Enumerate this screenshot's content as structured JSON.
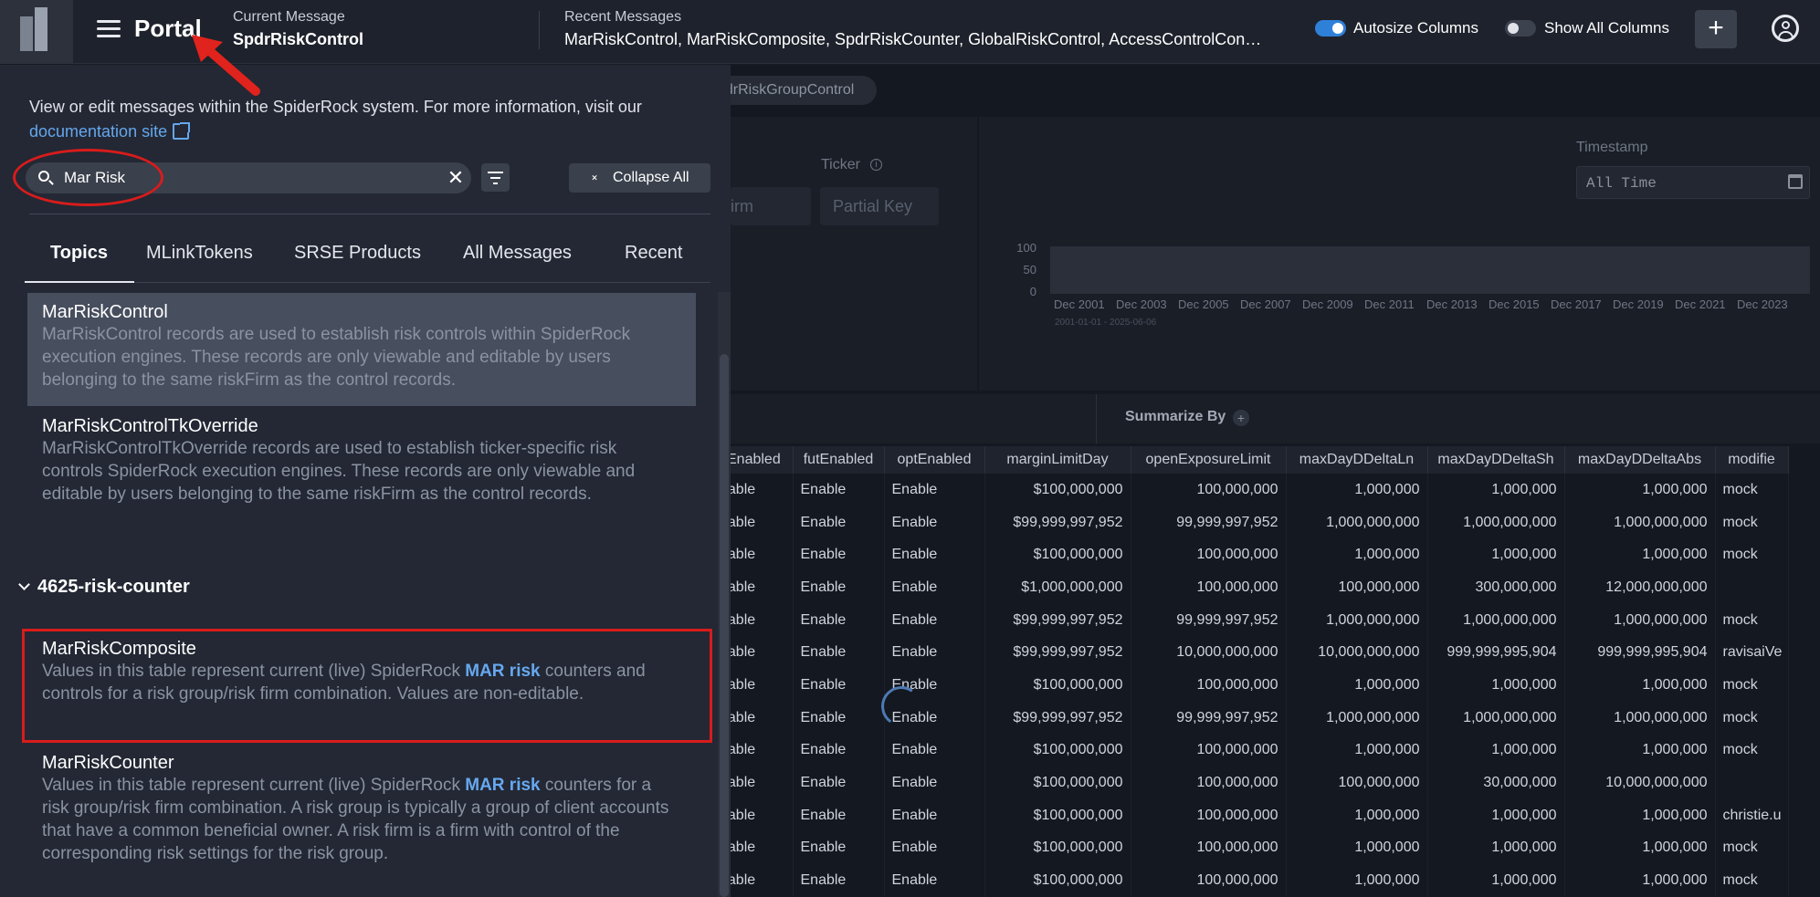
{
  "topbar": {
    "app_title": "Portal",
    "current_message_label": "Current Message",
    "current_message_value": "SpdrRiskControl",
    "recent_messages_label": "Recent Messages",
    "recent_messages_value": "MarRiskControl, MarRiskComposite, SpdrRiskCounter, GlobalRiskControl, AccessControlCon…",
    "autosize_label": "Autosize Columns",
    "autosize_on": true,
    "show_all_label": "Show All Columns",
    "show_all_on": false,
    "add_label": "+"
  },
  "drawer": {
    "intro_text": "View or edit messages within the SpiderRock system. For more information, visit our ",
    "doc_link": "documentation site",
    "search_value": "Mar Risk",
    "clear_label": "✕",
    "collapse_label": "Collapse All",
    "tabs": [
      "Topics",
      "MLinkTokens",
      "SRSE Products",
      "All Messages",
      "Recent"
    ],
    "active_tab": "Topics",
    "items_top": [
      {
        "title": "MarRiskControl",
        "desc": "MarRiskControl records are used to establish risk controls within SpiderRock execution engines. These records are only viewable and editable by users belonging to the same riskFirm as the control records."
      },
      {
        "title": "MarRiskControlTkOverride",
        "desc": "MarRiskControlTkOverride records are used to establish ticker-specific risk controls SpiderRock execution engines. These records are only viewable and editable by users belonging to the same riskFirm as the control records."
      }
    ],
    "group_label": "4625-risk-counter",
    "items_group": [
      {
        "title": "MarRiskComposite",
        "desc_pre": "Values in this table represent current (live) SpiderRock ",
        "desc_hl": "MAR risk",
        "desc_post": " counters and controls for a risk group/risk firm combination. Values are non-editable."
      },
      {
        "title": "MarRiskCounter",
        "desc_pre": "Values in this table represent current (live) SpiderRock ",
        "desc_hl": "MAR risk",
        "desc_post": " counters for a risk group/risk firm combination. A risk group is typically a group of client accounts that have a common beneficial owner. A risk firm is a firm with control of the corresponding risk settings for the risk group."
      }
    ]
  },
  "background": {
    "chip_label": "pdrRiskGroupControl",
    "ticker_label": "Ticker",
    "firm_placeholder": "irm",
    "partial_key_placeholder": "Partial Key",
    "timestamp_label": "Timestamp",
    "timestamp_value": "All Time",
    "chart_y_ticks": [
      "100",
      "50",
      "0"
    ],
    "chart_x_ticks": [
      "Dec 2001",
      "Dec 2003",
      "Dec 2005",
      "Dec 2007",
      "Dec 2009",
      "Dec 2011",
      "Dec 2013",
      "Dec 2015",
      "Dec 2017",
      "Dec 2019",
      "Dec 2021",
      "Dec 2023"
    ],
    "date_range": "2001-01-01 - 2025-06-06",
    "summarize_label": "Summarize By",
    "columns": [
      "kEnabled",
      "futEnabled",
      "optEnabled",
      "marginLimitDay",
      "openExposureLimit",
      "maxDayDDeltaLn",
      "maxDayDDeltaSh",
      "maxDayDDeltaAbs",
      "modifie"
    ],
    "rows": [
      [
        "nable",
        "Enable",
        "Enable",
        "$100,000,000",
        "100,000,000",
        "1,000,000",
        "1,000,000",
        "1,000,000",
        "mock"
      ],
      [
        "nable",
        "Enable",
        "Enable",
        "$99,999,997,952",
        "99,999,997,952",
        "1,000,000,000",
        "1,000,000,000",
        "1,000,000,000",
        "mock"
      ],
      [
        "nable",
        "Enable",
        "Enable",
        "$100,000,000",
        "100,000,000",
        "1,000,000",
        "1,000,000",
        "1,000,000",
        "mock"
      ],
      [
        "nable",
        "Enable",
        "Enable",
        "$1,000,000,000",
        "100,000,000",
        "100,000,000",
        "300,000,000",
        "12,000,000,000",
        ""
      ],
      [
        "nable",
        "Enable",
        "Enable",
        "$99,999,997,952",
        "99,999,997,952",
        "1,000,000,000",
        "1,000,000,000",
        "1,000,000,000",
        "mock"
      ],
      [
        "nable",
        "Enable",
        "Enable",
        "$99,999,997,952",
        "10,000,000,000",
        "10,000,000,000",
        "999,999,995,904",
        "999,999,995,904",
        "ravisaiVe"
      ],
      [
        "nable",
        "Enable",
        "Enable",
        "$100,000,000",
        "100,000,000",
        "1,000,000",
        "1,000,000",
        "1,000,000",
        "mock"
      ],
      [
        "nable",
        "Enable",
        "Enable",
        "$99,999,997,952",
        "99,999,997,952",
        "1,000,000,000",
        "1,000,000,000",
        "1,000,000,000",
        "mock"
      ],
      [
        "nable",
        "Enable",
        "Enable",
        "$100,000,000",
        "100,000,000",
        "1,000,000",
        "1,000,000",
        "1,000,000",
        "mock"
      ],
      [
        "nable",
        "Enable",
        "Enable",
        "$100,000,000",
        "100,000,000",
        "100,000,000",
        "30,000,000",
        "10,000,000,000",
        ""
      ],
      [
        "nable",
        "Enable",
        "Enable",
        "$100,000,000",
        "100,000,000",
        "1,000,000",
        "1,000,000",
        "1,000,000",
        "christie.u"
      ],
      [
        "nable",
        "Enable",
        "Enable",
        "$100,000,000",
        "100,000,000",
        "1,000,000",
        "1,000,000",
        "1,000,000",
        "mock"
      ],
      [
        "nable",
        "Enable",
        "Enable",
        "$100,000,000",
        "100,000,000",
        "1,000,000",
        "1,000,000",
        "1,000,000",
        "mock"
      ]
    ]
  },
  "colors": {
    "accent": "#2f80d8",
    "highlight": "#67a8f0",
    "annotation": "#d81c1c"
  }
}
